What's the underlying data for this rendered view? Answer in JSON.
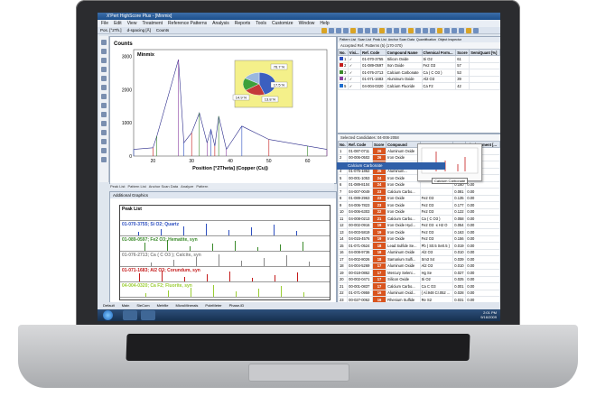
{
  "window": {
    "title": "X'Pert HighScore Plus - [Minmix]"
  },
  "menu": [
    "File",
    "Edit",
    "View",
    "Treatment",
    "Reference Patterns",
    "Analysis",
    "Reports",
    "Tools",
    "Customize",
    "Window",
    "Help"
  ],
  "toolbar": {
    "items": [
      "Pos. [°2Th.]",
      "d-spacing [Å]",
      "Counts"
    ]
  },
  "chart": {
    "ylabel": "Counts",
    "title": "Minmix",
    "xlabel": "Position [°2Theta] (Copper (Cu))",
    "yticks": [
      "3000",
      "2000",
      "1000",
      "0"
    ],
    "xticks": [
      "20",
      "30",
      "40",
      "50",
      "60"
    ]
  },
  "chart_data": {
    "type": "line",
    "title": "Minmix",
    "xlabel": "Position [°2Theta] (Copper (Cu))",
    "ylabel": "Counts",
    "xlim": [
      15,
      65
    ],
    "ylim": [
      0,
      3200
    ],
    "x": [
      15,
      20,
      21,
      26.6,
      28,
      30,
      32,
      34,
      35,
      36,
      37,
      39,
      43,
      50,
      60,
      65
    ],
    "series": [
      {
        "values": [
          200,
          250,
          600,
          2900,
          400,
          700,
          1300,
          400,
          800,
          300,
          1200,
          200,
          900,
          500,
          300,
          200
        ]
      }
    ],
    "pie": {
      "labels": [
        "76.7 %",
        "17.5 %",
        "14.9 %",
        "13.8 %"
      ],
      "values": [
        37,
        17.5,
        14.9,
        13.8
      ]
    }
  },
  "chart_tabs": [
    "Peak List",
    "Pattern List",
    "Anchor Scan Data",
    "Analyze",
    "Pattern"
  ],
  "peak_list": {
    "header": "Additional Graphics",
    "title": "Peak List",
    "rows": [
      "01-070-3755; Si O2; Quartz",
      "01-089-0597; Fe2 O3; Hematite, syn",
      "01-076-2713; Ca ( C O3 ); Calcite, syn",
      "01-071-1683; Al2 O3; Corundum, syn",
      "04-004-0320; Ca F2; Fluorite, syn"
    ],
    "row_colors": [
      "#2d4fc0",
      "#3a8a2a",
      "#888888",
      "#c41a1a",
      "#9acd32"
    ]
  },
  "right_top": {
    "tabs": [
      "Pattern List",
      "Scan List",
      "Peak List",
      "Anchor Scan Data",
      "Quantification",
      "Object Inspector"
    ],
    "subtitle": "Accepted Ref. Patterns (5) (170-370)",
    "columns": [
      "No.",
      "Visi...",
      "Ref. Code",
      "Compound Name",
      "Chemical Form...",
      "Score",
      "SemiQuant [%]"
    ],
    "rows": [
      {
        "no": "1",
        "code": "01-070-3755",
        "name": "Silicon Oxide",
        "formula": "Si O2",
        "score": "61",
        "color": "#2d4fc0"
      },
      {
        "no": "2",
        "code": "01-089-0597",
        "name": "Iron Oxide",
        "formula": "Fe2 O3",
        "score": "57",
        "color": "#c41a1a"
      },
      {
        "no": "3",
        "code": "01-076-2713",
        "name": "Calcium Carbonate",
        "formula": "Ca ( C O3 )",
        "score": "53",
        "color": "#3a8a2a"
      },
      {
        "no": "4",
        "code": "01-071-1683",
        "name": "Aluminum Oxide",
        "formula": "Al2 O3",
        "score": "39",
        "color": "#8b3fa0"
      },
      {
        "no": "5",
        "code": "04-004-0320",
        "name": "Calcium Fluoride",
        "formula": "Ca F2",
        "score": "42",
        "color": "#1f6fd0"
      }
    ]
  },
  "right_bottom": {
    "subtitle": "Selected Candidates: 04-006-2058",
    "columns": [
      "No.",
      "Ref. Code",
      "Score",
      "Compound",
      "",
      "",
      "Displacement [..."
    ],
    "rows": [
      {
        "no": "1",
        "code": "01-087-0711",
        "score": "26",
        "name": "Aluminum Oxide",
        "formula": "",
        "sf": "0.069",
        "d": "0.00"
      },
      {
        "no": "2",
        "code": "00-006-0502",
        "score": "26",
        "name": "Iron Oxide",
        "formula": "",
        "sf": "0.072",
        "d": "0.00"
      },
      {
        "no": "3",
        "code": "00-013-0534",
        "score": "26",
        "name": "Iron Oxide",
        "formula": "",
        "sf": "0.080",
        "d": "0.00"
      },
      {
        "no": "4",
        "code": "01-075-1862",
        "score": "25",
        "name": "Aluminum...",
        "formula": "",
        "sf": "0.080",
        "d": "0.00"
      },
      {
        "no": "5",
        "code": "00-001-1053",
        "score": "24",
        "name": "Iron Oxide",
        "formula": "",
        "sf": "0.077",
        "d": "0.00"
      },
      {
        "no": "6",
        "code": "01-089-8104",
        "score": "24",
        "name": "Iron Oxide",
        "formula": "",
        "sf": "0.160",
        "d": "0.00"
      },
      {
        "no": "7",
        "code": "04-007-0049",
        "score": "23",
        "name": "Calcium Carbo...",
        "formula": "",
        "sf": "0.081",
        "d": "0.00"
      },
      {
        "no": "8",
        "code": "01-089-2963",
        "score": "23",
        "name": "Iron Oxide",
        "formula": "Fe2 O3",
        "sf": "0.135",
        "d": "0.00"
      },
      {
        "no": "9",
        "code": "04-006-7823",
        "score": "23",
        "name": "Iron Oxide",
        "formula": "Fe2 O3",
        "sf": "0.177",
        "d": "0.00"
      },
      {
        "no": "10",
        "code": "04-006-6303",
        "score": "22",
        "name": "Iron Oxide",
        "formula": "Fe2 O3",
        "sf": "0.122",
        "d": "0.00"
      },
      {
        "no": "11",
        "code": "04-008-0213",
        "score": "21",
        "name": "Calcium Carbo...",
        "formula": "Ca ( C O3 )",
        "sf": "0.058",
        "d": "0.00"
      },
      {
        "no": "12",
        "code": "00-002-0916",
        "score": "19",
        "name": "Iron Oxide Hyd...",
        "formula": "Fe2 O3 ·x H2 O",
        "sf": "0.054",
        "d": "0.00"
      },
      {
        "no": "13",
        "code": "04-003-5819",
        "score": "19",
        "name": "Iron Oxide",
        "formula": "Fe2 O3",
        "sf": "0.163",
        "d": "0.00"
      },
      {
        "no": "14",
        "code": "04-015-4576",
        "score": "19",
        "name": "Iron Oxide",
        "formula": "Fe2 O3",
        "sf": "0.156",
        "d": "0.00"
      },
      {
        "no": "15",
        "code": "01-071-0524",
        "score": "18",
        "name": "Lead Sulfide Se...",
        "formula": "Pb ( S0.5 Se0.5 )",
        "sf": "0.019",
        "d": "0.00"
      },
      {
        "no": "16",
        "code": "04-008-9736",
        "score": "18",
        "name": "Aluminum Oxide",
        "formula": "Al2 O3",
        "sf": "0.010",
        "d": "0.00"
      },
      {
        "no": "17",
        "code": "04-002-8026",
        "score": "18",
        "name": "Samarium Sulfi...",
        "formula": "Sm3 S4",
        "sf": "0.039",
        "d": "0.00"
      },
      {
        "no": "18",
        "code": "04-004-5269",
        "score": "17",
        "name": "Aluminum Oxide",
        "formula": "Al2 O3",
        "sf": "0.010",
        "d": "0.00"
      },
      {
        "no": "19",
        "code": "00-018-0862",
        "score": "17",
        "name": "Mercury Seleni...",
        "formula": "Hg Se",
        "sf": "0.027",
        "d": "0.00"
      },
      {
        "no": "20",
        "code": "00-002-0471",
        "score": "17",
        "name": "Silicon Oxide",
        "formula": "Si O2",
        "sf": "0.025",
        "d": "0.00"
      },
      {
        "no": "21",
        "code": "00-001-0837",
        "score": "17",
        "name": "Calcium Carbo...",
        "formula": "Ca C O3",
        "sf": "0.001",
        "d": "0.00"
      },
      {
        "no": "22",
        "code": "01-071-0959",
        "score": "16",
        "name": "Aluminum Oxid...",
        "formula": "( Al.948 Cr.052 ...",
        "sf": "0.028",
        "d": "0.00"
      },
      {
        "no": "23",
        "code": "00-027-0062",
        "score": "16",
        "name": "Rhenium Sulfide",
        "formula": "Re S2",
        "sf": "0.031",
        "d": "0.00"
      }
    ],
    "highlight": "Calcium Carbonate",
    "popup_tag": "Calcium Carbonate"
  },
  "statusbar": [
    "Default",
    "Main",
    "SieCom",
    "Mehfile",
    "MicroMinerals",
    "PoleMeter",
    "Phase-ID"
  ],
  "taskbar": {
    "time": "2:01 PM",
    "date": "9/16/2009"
  }
}
